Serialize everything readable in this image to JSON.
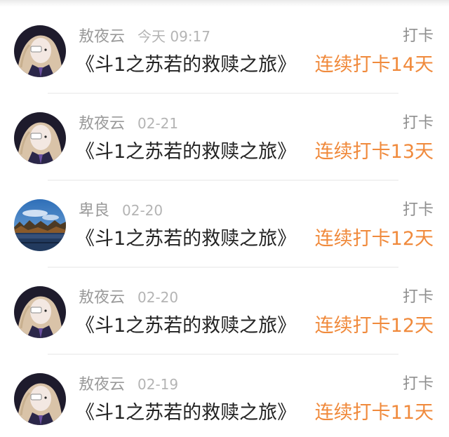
{
  "feed": {
    "items": [
      {
        "user": "敖夜云",
        "time": "今天 09:17",
        "action": "打卡",
        "title": "《斗1之苏若的救赎之旅》",
        "streak": "连续打卡14天",
        "avatar": "anime-girl-avatar"
      },
      {
        "user": "敖夜云",
        "time": "02-21",
        "action": "打卡",
        "title": "《斗1之苏若的救赎之旅》",
        "streak": "连续打卡13天",
        "avatar": "anime-girl-avatar"
      },
      {
        "user": "卑良",
        "time": "02-20",
        "action": "打卡",
        "title": "《斗1之苏若的救赎之旅》",
        "streak": "连续打卡12天",
        "avatar": "landscape-avatar"
      },
      {
        "user": "敖夜云",
        "time": "02-20",
        "action": "打卡",
        "title": "《斗1之苏若的救赎之旅》",
        "streak": "连续打卡12天",
        "avatar": "anime-girl-avatar"
      },
      {
        "user": "敖夜云",
        "time": "02-19",
        "action": "打卡",
        "title": "《斗1之苏若的救赎之旅》",
        "streak": "连续打卡11天",
        "avatar": "anime-girl-avatar"
      }
    ]
  },
  "colors": {
    "streak": "#f08a3c",
    "title": "#222222",
    "meta": "#9a9a9a",
    "divider": "#f2f2f2"
  }
}
